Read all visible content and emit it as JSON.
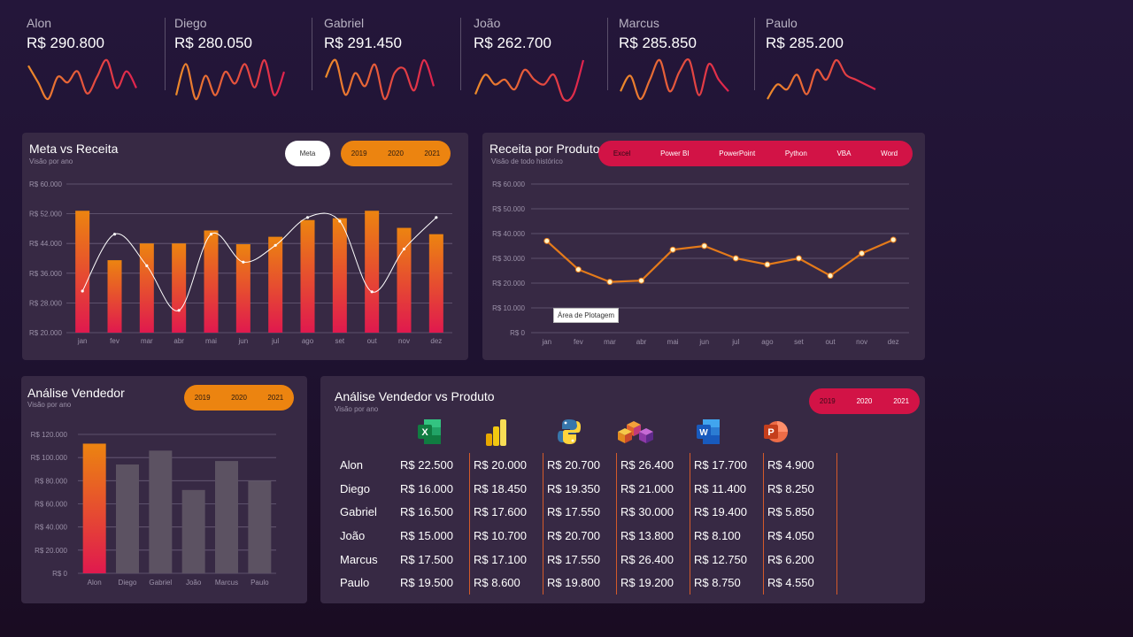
{
  "kpis": [
    {
      "name": "Alon",
      "value": "R$ 290.800",
      "spark": [
        10,
        7,
        4,
        8,
        7,
        9,
        5,
        8,
        11,
        6,
        9,
        6
      ]
    },
    {
      "name": "Diego",
      "value": "R$ 280.050",
      "spark": [
        6,
        14,
        5,
        11,
        6,
        12,
        9,
        14,
        8,
        15,
        6,
        12
      ]
    },
    {
      "name": "Gabriel",
      "value": "R$ 291.450",
      "spark": [
        8,
        12,
        4,
        9,
        6,
        11,
        3,
        9,
        10,
        5,
        12,
        6
      ]
    },
    {
      "name": "João",
      "value": "R$ 262.700",
      "spark": [
        8,
        12,
        10,
        11,
        9,
        13,
        11,
        10,
        12,
        7,
        8,
        15
      ]
    },
    {
      "name": "Marcus",
      "value": "R$ 285.850",
      "spark": [
        6,
        10,
        4,
        9,
        14,
        6,
        11,
        14,
        5,
        13,
        9,
        6
      ]
    },
    {
      "name": "Paulo",
      "value": "R$ 285.200",
      "spark": [
        4,
        7,
        6,
        9,
        5,
        10,
        8,
        12,
        9,
        8,
        7,
        6
      ]
    }
  ],
  "meta_receita": {
    "title": "Meta vs Receita",
    "subtitle": "Visão por ano",
    "meta_label": "Meta",
    "years": [
      "2019",
      "2020",
      "2021"
    ]
  },
  "receita_produto": {
    "title": "Receita por Produto",
    "subtitle": "Visão de todo histórico",
    "products": [
      "Excel",
      "Power BI",
      "PowerPoint",
      "Python",
      "VBA",
      "Word"
    ],
    "tooltip": "Área de Plotagem"
  },
  "analise_vendedor": {
    "title": "Análise Vendedor",
    "subtitle": "Visão por ano",
    "years": [
      "2019",
      "2020",
      "2021"
    ]
  },
  "vendedor_produto": {
    "title": "Análise Vendedor vs Produto",
    "subtitle": "Visão por ano",
    "years": [
      "2019",
      "2020",
      "2021"
    ],
    "products": [
      "Excel",
      "Power BI",
      "Python",
      "VBA",
      "Word",
      "PowerPoint"
    ],
    "rows": [
      {
        "name": "Alon",
        "values": [
          "R$ 22.500",
          "R$ 20.000",
          "R$ 20.700",
          "R$ 26.400",
          "R$ 17.700",
          "R$ 4.900"
        ]
      },
      {
        "name": "Diego",
        "values": [
          "R$ 16.000",
          "R$ 18.450",
          "R$ 19.350",
          "R$ 21.000",
          "R$ 11.400",
          "R$ 8.250"
        ]
      },
      {
        "name": "Gabriel",
        "values": [
          "R$ 16.500",
          "R$ 17.600",
          "R$ 17.550",
          "R$ 30.000",
          "R$ 19.400",
          "R$ 5.850"
        ]
      },
      {
        "name": "João",
        "values": [
          "R$ 15.000",
          "R$ 10.700",
          "R$ 20.700",
          "R$ 13.800",
          "R$ 8.100",
          "R$ 4.050"
        ]
      },
      {
        "name": "Marcus",
        "values": [
          "R$ 17.500",
          "R$ 17.100",
          "R$ 17.550",
          "R$ 26.400",
          "R$ 12.750",
          "R$ 6.200"
        ]
      },
      {
        "name": "Paulo",
        "values": [
          "R$ 19.500",
          "R$ 8.600",
          "R$ 19.800",
          "R$ 19.200",
          "R$ 8.750",
          "R$ 4.550"
        ]
      }
    ]
  },
  "colors": {
    "orange": "#ec8410",
    "red": "#d21346",
    "panel": "#372944",
    "background": "#24163a"
  },
  "chart_data": [
    {
      "type": "bar",
      "categories": [
        "jan",
        "fev",
        "mar",
        "abr",
        "mai",
        "jun",
        "jul",
        "ago",
        "set",
        "out",
        "nov",
        "dez"
      ],
      "series": [
        {
          "values": [
            52800,
            39500,
            44000,
            44000,
            47500,
            43800,
            45800,
            50300,
            50800,
            52800,
            48200,
            46500
          ]
        },
        {
          "values": [
            31200,
            46500,
            38000,
            26000,
            46500,
            39000,
            43500,
            51000,
            50000,
            31000,
            42500,
            51000
          ]
        }
      ],
      "yticks": [
        "R$ 20.000",
        "R$ 28.000",
        "R$ 36.000",
        "R$ 44.000",
        "R$ 52.000",
        "R$ 60.000"
      ],
      "ylim": [
        20000,
        60000
      ],
      "grid": true
    },
    {
      "type": "line",
      "categories": [
        "jan",
        "fev",
        "mar",
        "abr",
        "mai",
        "jun",
        "jul",
        "ago",
        "set",
        "out",
        "nov",
        "dez"
      ],
      "values": [
        37000,
        25500,
        20500,
        21000,
        33500,
        35000,
        30000,
        27500,
        30000,
        23000,
        32000,
        37500
      ],
      "yticks": [
        "R$ 0",
        "R$ 10.000",
        "R$ 20.000",
        "R$ 30.000",
        "R$ 40.000",
        "R$ 50.000",
        "R$ 60.000"
      ],
      "ylim": [
        0,
        60000
      ],
      "grid": true
    },
    {
      "type": "bar",
      "categories": [
        "Alon",
        "Diego",
        "Gabriel",
        "João",
        "Marcus",
        "Paulo"
      ],
      "values": [
        112000,
        94000,
        106000,
        72000,
        97000,
        80000
      ],
      "yticks": [
        "R$ 0",
        "R$ 20.000",
        "R$ 40.000",
        "R$ 60.000",
        "R$ 80.000",
        "R$ 100.000",
        "R$ 120.000"
      ],
      "ylim": [
        0,
        120000
      ],
      "grid": true
    }
  ]
}
